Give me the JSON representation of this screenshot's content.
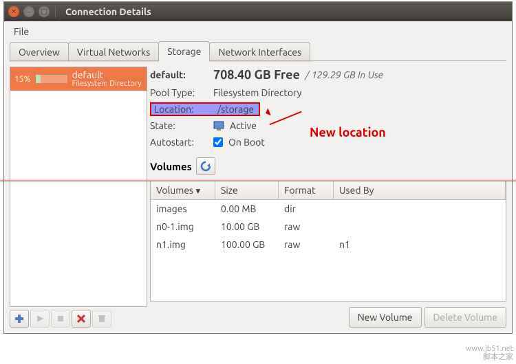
{
  "window": {
    "title": "Connection Details"
  },
  "menubar": {
    "file": "File"
  },
  "tabs": {
    "overview": "Overview",
    "vnet": "Virtual Networks",
    "storage": "Storage",
    "niface": "Network Interfaces"
  },
  "sidebar": {
    "pool": {
      "pct": "15%",
      "name": "default",
      "sub": "Filesystem Directory"
    }
  },
  "details": {
    "name_label": "default:",
    "free": "708.40 GB Free",
    "inuse": "/ 129.29 GB In Use",
    "pooltype_label": "Pool Type:",
    "pooltype": "Filesystem Directory",
    "location_label": "Location:",
    "location": "/storage",
    "state_label": "State:",
    "state": "Active",
    "autostart_label": "Autostart:",
    "autostart": "On Boot",
    "volumes_label": "Volumes"
  },
  "grid": {
    "headers": {
      "vol": "Volumes",
      "size": "Size",
      "format": "Format",
      "usedby": "Used By"
    },
    "rows": [
      {
        "vol": "images",
        "size": "0.00 MB",
        "format": "dir",
        "usedby": ""
      },
      {
        "vol": "n0-1.img",
        "size": "10.00 GB",
        "format": "raw",
        "usedby": ""
      },
      {
        "vol": "n1.img",
        "size": "100.00 GB",
        "format": "raw",
        "usedby": "n1"
      }
    ]
  },
  "buttons": {
    "newvol": "New Volume",
    "delvol": "Delete Volume"
  },
  "annotation": {
    "text": "New location"
  },
  "watermark": {
    "l1": "www.jb51.net",
    "l2": "脚本之家"
  }
}
